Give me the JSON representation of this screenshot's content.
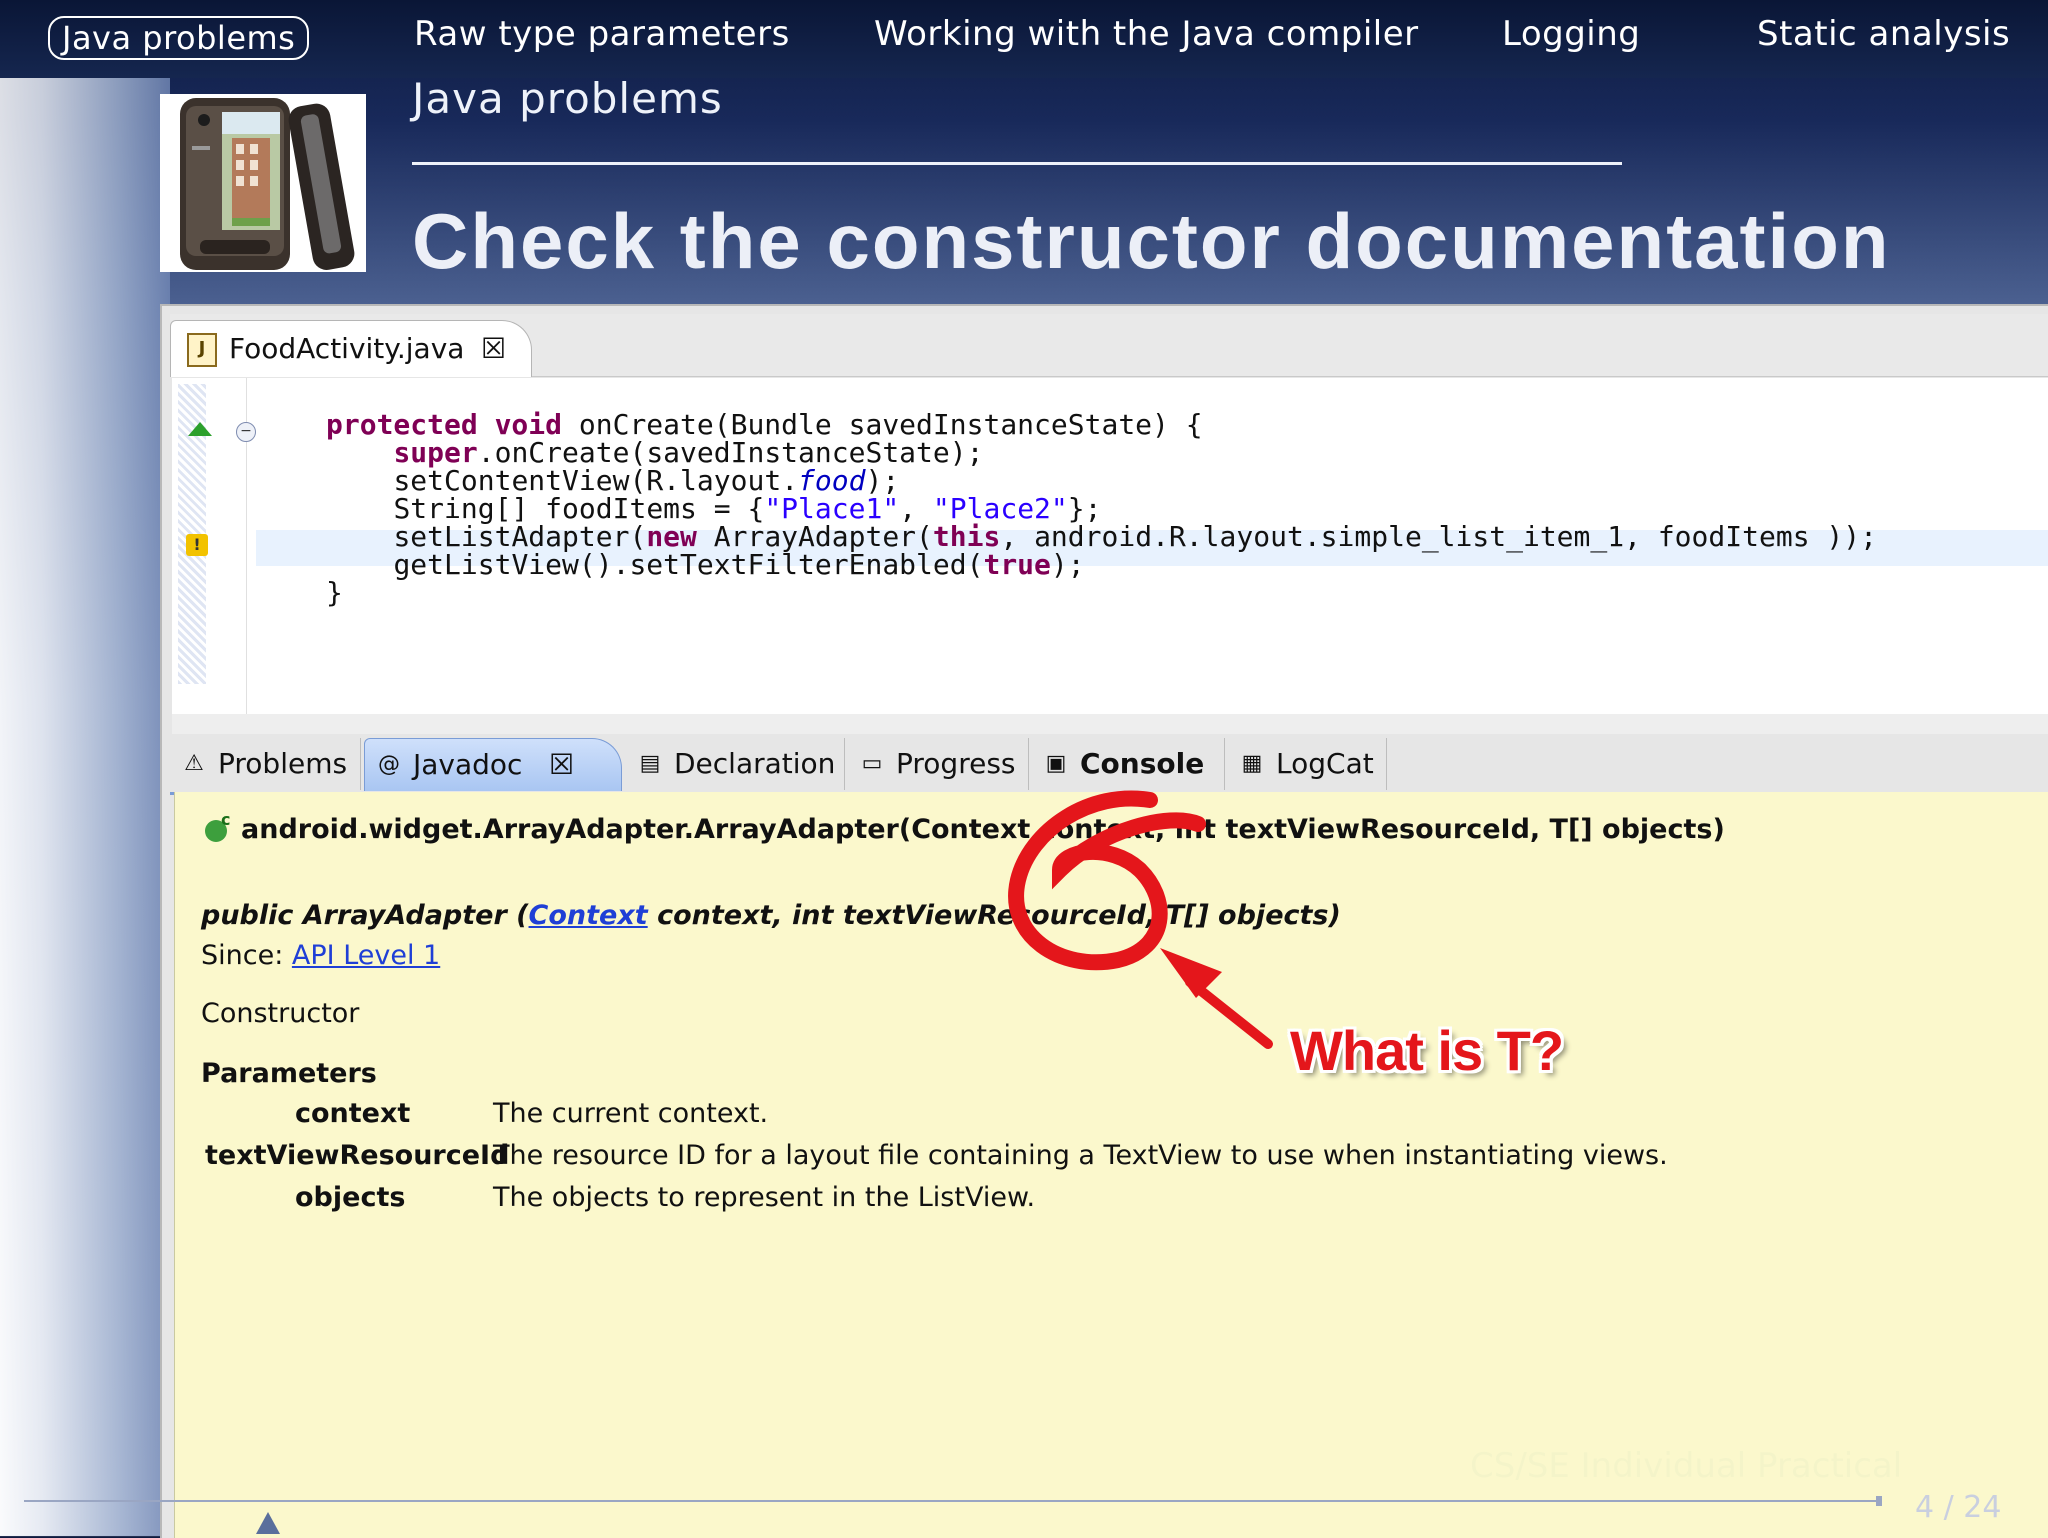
{
  "nav": {
    "items": [
      "Java problems",
      "Raw type parameters",
      "Working with the Java compiler",
      "Logging",
      "Static analysis"
    ],
    "active_index": 0
  },
  "slide": {
    "section": "Java problems",
    "title": "Check the constructor documentation"
  },
  "editor": {
    "tab_label": "FoodActivity.java",
    "tab_close": "☒",
    "code_lines": [
      "protected void onCreate(Bundle savedInstanceState) {",
      "    super.onCreate(savedInstanceState);",
      "    setContentView(R.layout.food);",
      "    String[] foodItems = {\"Place1\", \"Place2\"};",
      "    setListAdapter(new ArrayAdapter(this, android.R.layout.simple_list_item_1, foodItems ));",
      "    getListView().setTextFilterEnabled(true);",
      "}"
    ]
  },
  "panel": {
    "tabs": [
      "Problems",
      "Javadoc",
      "Declaration",
      "Progress",
      "Console",
      "LogCat"
    ],
    "active_tab": "Javadoc",
    "javadoc_close": "☒"
  },
  "javadoc": {
    "signature": "android.widget.ArrayAdapter.ArrayAdapter(Context context, int textViewResourceId, T[] objects)",
    "decl_prefix": "public ArrayAdapter (",
    "decl_link": "Context",
    "decl_suffix": " context, int textViewResourceId, T[] objects)",
    "since_label": "Since: ",
    "since_link": "API Level 1",
    "kind": "Constructor",
    "params_heading": "Parameters",
    "params": [
      {
        "name": "context",
        "desc": "The current context."
      },
      {
        "name": "textViewResourceId",
        "desc": "The resource ID for a layout file containing a TextView to use when instantiating views."
      },
      {
        "name": "objects",
        "desc": "The objects to represent in the ListView."
      }
    ]
  },
  "annotation": {
    "label": "What is T?",
    "color": "#e4161b"
  },
  "footer": {
    "course": "CS/SE Individual Practical",
    "page": "4 / 24"
  }
}
